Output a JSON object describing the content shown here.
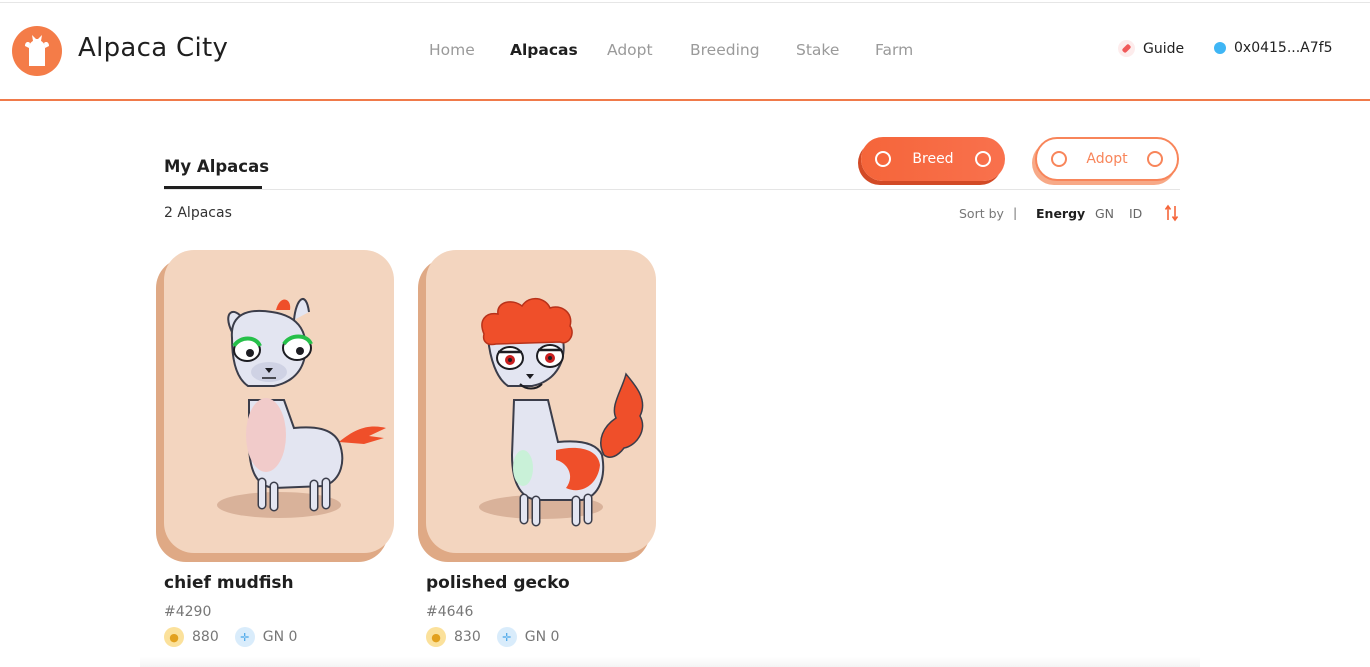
{
  "header": {
    "app_title": "Alpaca City",
    "nav": [
      {
        "label": "Home",
        "active": false
      },
      {
        "label": "Alpacas",
        "active": true
      },
      {
        "label": "Adopt",
        "active": false
      },
      {
        "label": "Breeding",
        "active": false
      },
      {
        "label": "Stake",
        "active": false
      },
      {
        "label": "Farm",
        "active": false
      }
    ],
    "guide_label": "Guide",
    "wallet_address": "0x0415...A7f5"
  },
  "section": {
    "title": "My Alpacas",
    "breed_button": "Breed",
    "adopt_button": "Adopt",
    "count_label": "2 Alpacas",
    "sort_label": "Sort by",
    "sort_separator": "|",
    "sort_options": [
      {
        "label": "Energy",
        "active": true
      },
      {
        "label": "GN",
        "active": false
      },
      {
        "label": "ID",
        "active": false
      }
    ]
  },
  "alpacas": [
    {
      "name": "chief mudfish",
      "id": "#4290",
      "energy": "880",
      "gn": "GN 0"
    },
    {
      "name": "polished gecko",
      "id": "#4646",
      "energy": "830",
      "gn": "GN 0"
    }
  ],
  "colors": {
    "accent": "#f5653a",
    "card_background": "#f3d5bf",
    "card_shadow": "#dfa985",
    "wallet_dot": "#3fb6f5"
  },
  "icons": {
    "logo": "alpaca-logo",
    "guide": "compass-icon",
    "energy": "energy-coin-icon",
    "gn": "dna-icon",
    "sort_toggle": "sort-order-icon"
  }
}
